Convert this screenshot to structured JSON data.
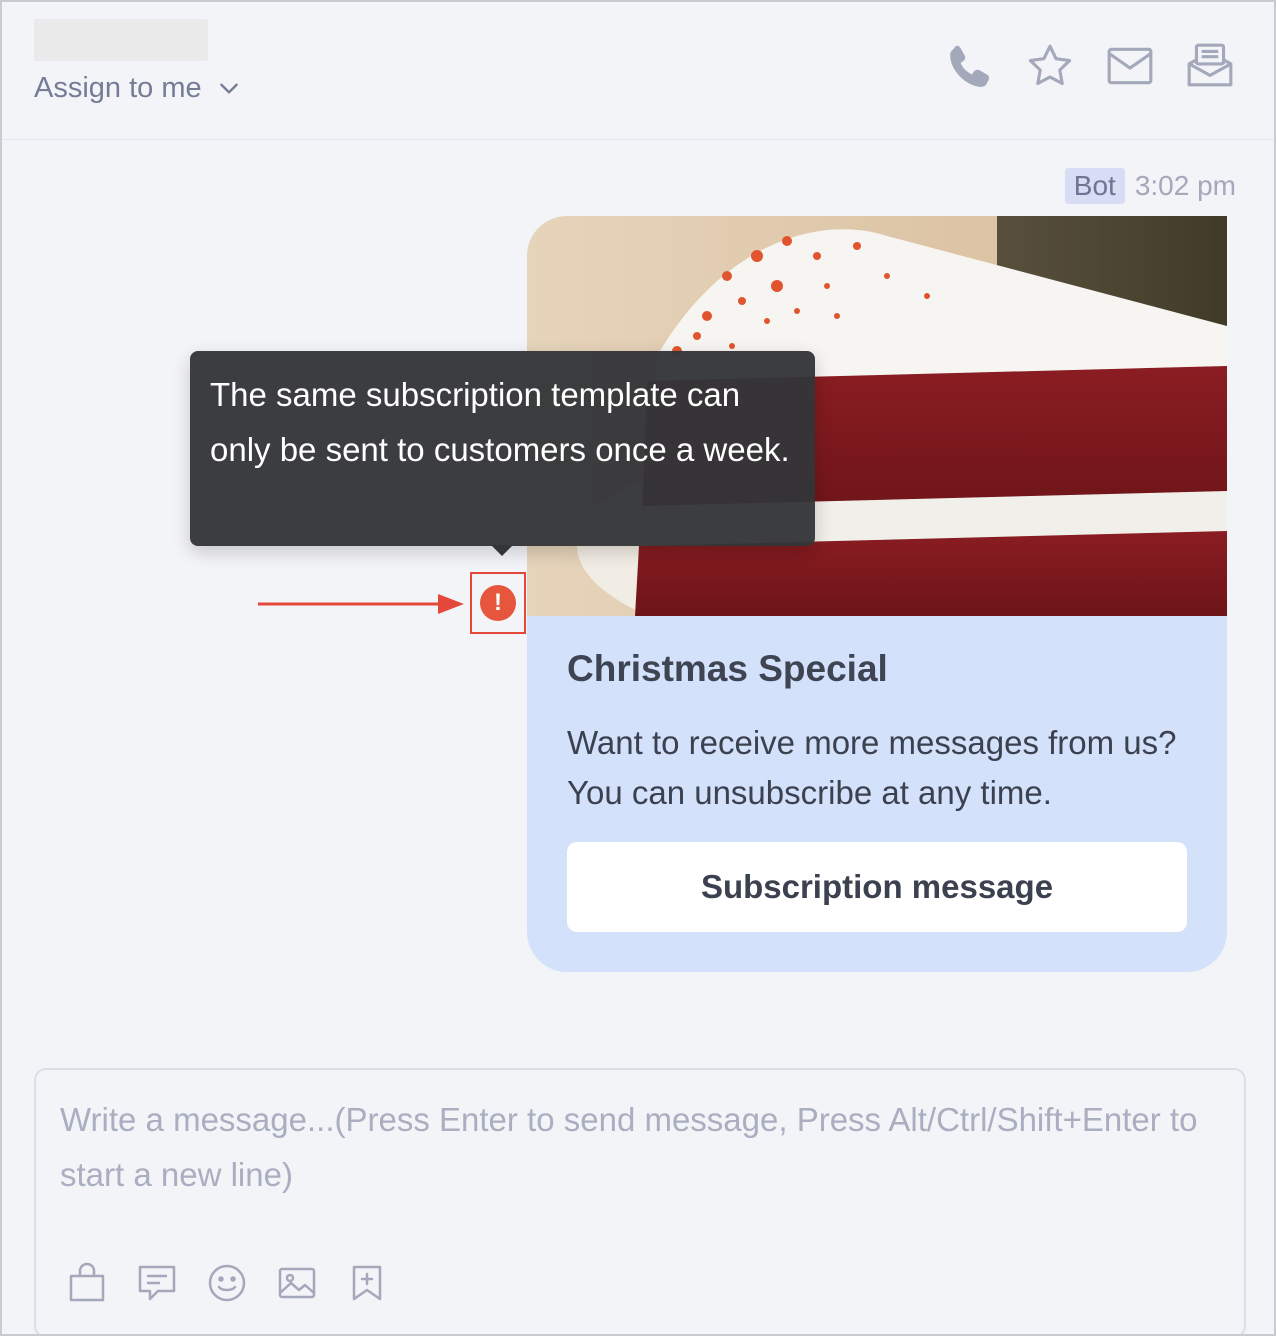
{
  "header": {
    "assign_label": "Assign to me",
    "icons": [
      "phone-icon",
      "star-icon",
      "mail-icon",
      "inbox-icon"
    ]
  },
  "message": {
    "sender_badge": "Bot",
    "time": "3:02 pm",
    "card": {
      "title": "Christmas Special",
      "text": "Want to receive more messages from us? You can unsubscribe at any time.",
      "button_label": "Subscription message"
    },
    "tooltip": "The same subscription template can only be sent to customers once a week.",
    "error_icon": "exclamation-icon"
  },
  "composer": {
    "placeholder": "Write a message...(Press Enter to send message, Press Alt/Ctrl/Shift+Enter to start a new line)",
    "value": "",
    "tools": [
      "shopping-bag-icon",
      "quick-reply-icon",
      "emoji-icon",
      "image-icon",
      "bookmark-add-icon"
    ]
  },
  "colors": {
    "card_bg": "#d3e1fb",
    "error": "#e5563c",
    "tooltip_bg": "#343538",
    "icon_gray": "#a3a8ba"
  }
}
